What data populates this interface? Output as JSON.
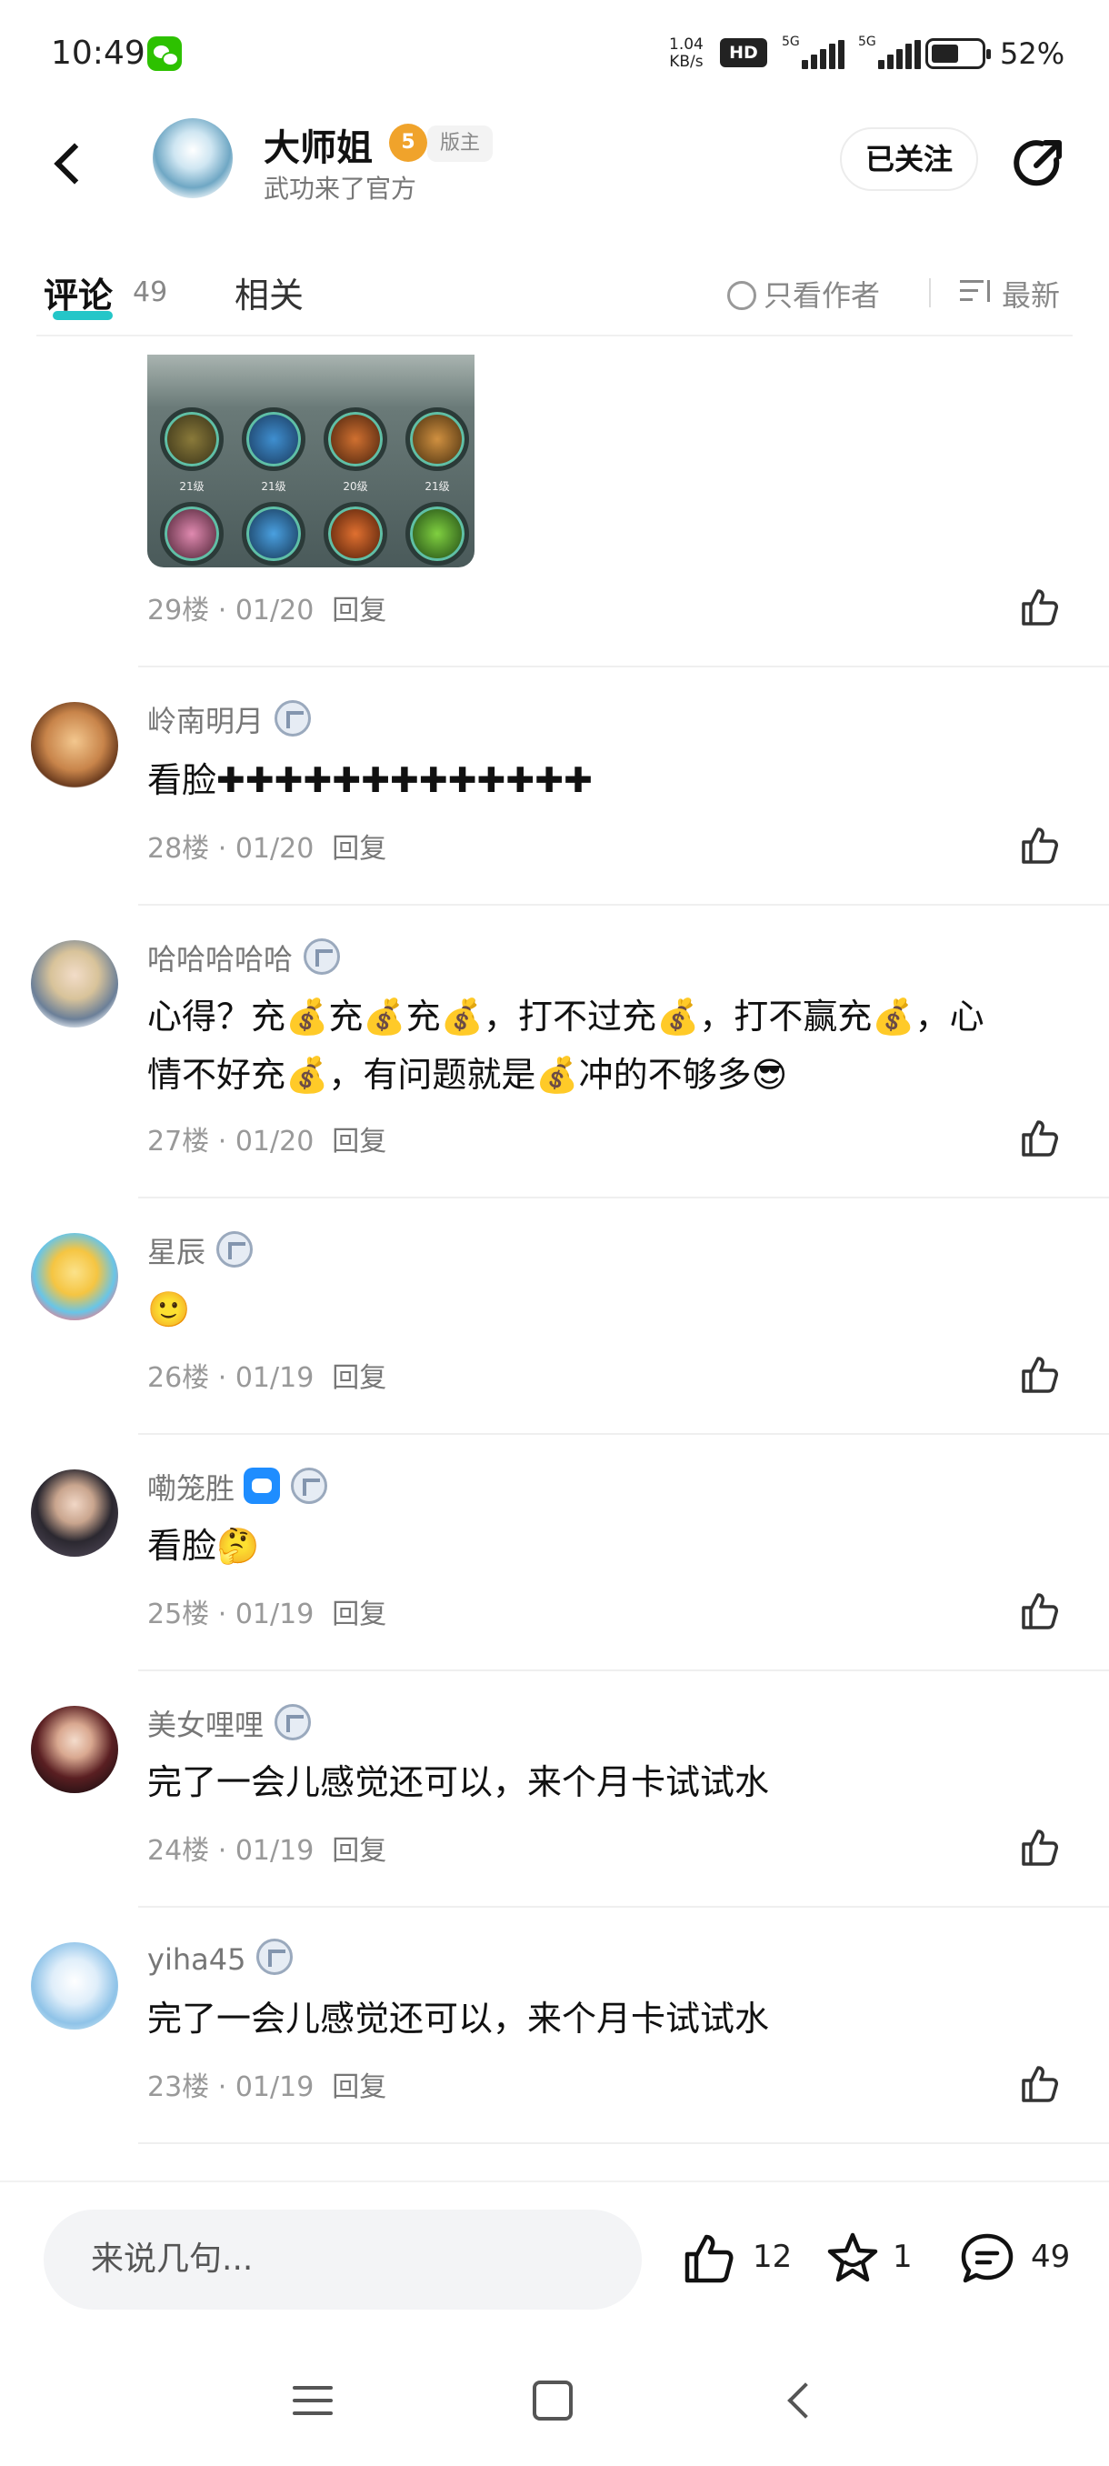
{
  "status_bar": {
    "time": "10:49",
    "net_speed_value": "1.04",
    "net_speed_unit": "KB/s",
    "hd_label": "HD",
    "sim1_label": "5G",
    "sim2_label": "5G",
    "battery_pct": "52%"
  },
  "header": {
    "author_name": "大师姐",
    "level_badge": "5",
    "moderator_label": "版主",
    "author_subtitle": "武功来了官方",
    "follow_label": "已关注"
  },
  "tabs": {
    "comments_label": "评论",
    "comments_count": "49",
    "related_label": "相关",
    "author_only_label": "只看作者",
    "sort_label": "最新"
  },
  "comments": [
    {
      "id": "29",
      "floor_label": "29楼",
      "date": "01/20",
      "reply_label": "回复",
      "has_image": true,
      "image_skill_levels": [
        "21级",
        "21级",
        "20级",
        "21级"
      ]
    },
    {
      "id": "28",
      "username": "岭南明月",
      "text": "看脸✚✚✚✚✚✚✚✚✚✚✚✚✚",
      "floor_label": "28楼",
      "date": "01/20",
      "reply_label": "回复"
    },
    {
      "id": "27",
      "username": "哈哈哈哈哈",
      "text_line1": "心得？充💰充💰充💰，打不过充💰，打不赢充💰，心",
      "text_line2": "情不好充💰，有问题就是💰冲的不够多😎",
      "floor_label": "27楼",
      "date": "01/20",
      "reply_label": "回复"
    },
    {
      "id": "26",
      "username": "星辰",
      "text": "🙂",
      "floor_label": "26楼",
      "date": "01/19",
      "reply_label": "回复"
    },
    {
      "id": "25",
      "username": "嘞笼胜",
      "text": "看脸🤔",
      "floor_label": "25楼",
      "date": "01/19",
      "reply_label": "回复"
    },
    {
      "id": "24",
      "username": "美女哩哩",
      "text": "完了一会儿感觉还可以，来个月卡试试水",
      "floor_label": "24楼",
      "date": "01/19",
      "reply_label": "回复"
    },
    {
      "id": "23",
      "username": "yiha45",
      "text": "完了一会儿感觉还可以，来个月卡试试水",
      "floor_label": "23楼",
      "date": "01/19",
      "reply_label": "回复"
    }
  ],
  "meta_separator": "·",
  "bottom_bar": {
    "input_placeholder": "来说几句...",
    "like_count": "12",
    "favorite_count": "1",
    "comment_count": "49"
  },
  "icons": {
    "back": "back-arrow-icon",
    "share": "share-icon",
    "like": "thumbs-up-icon",
    "favorite": "star-icon",
    "comment": "comment-bubble-icon"
  },
  "colors": {
    "accent": "#24c6c8",
    "level_badge": "#f0a32b",
    "muted_text": "#999999"
  }
}
